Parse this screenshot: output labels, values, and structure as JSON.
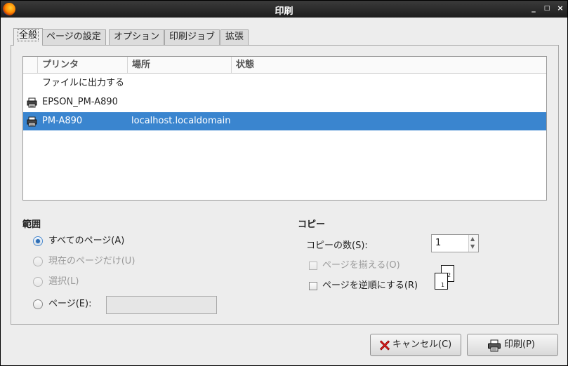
{
  "window": {
    "title": "印刷",
    "controls": [
      "_",
      "□",
      "×"
    ]
  },
  "tabs": [
    {
      "label": "全般",
      "active": true
    },
    {
      "label": "ページの設定",
      "active": false
    },
    {
      "label": "オプション",
      "active": false
    },
    {
      "label": "印刷ジョブ",
      "active": false
    },
    {
      "label": "拡張",
      "active": false
    }
  ],
  "printer_list": {
    "columns": [
      "プリンタ",
      "場所",
      "状態"
    ],
    "rows": [
      {
        "name": "ファイルに出力する",
        "location": "",
        "status": "",
        "icon": null,
        "selected": false
      },
      {
        "name": "EPSON_PM-A890",
        "location": "",
        "status": "",
        "icon": "printer-icon",
        "selected": false
      },
      {
        "name": "PM-A890",
        "location": "localhost.localdomain",
        "status": "",
        "icon": "printer-icon",
        "selected": true
      }
    ]
  },
  "range": {
    "title": "範囲",
    "all_pages": "すべてのページ(A)",
    "current_page": "現在のページだけ(U)",
    "selection": "選択(L)",
    "pages": "ページ(E):",
    "pages_value": ""
  },
  "copies": {
    "title": "コピー",
    "count_label": "コピーの数(S):",
    "count_value": "1",
    "collate": "ページを揃える(O)",
    "reverse": "ページを逆順にする(R)",
    "collate_icon_pages": [
      "1",
      "2"
    ]
  },
  "buttons": {
    "cancel": "キャンセル(C)",
    "print": "印刷(P)"
  },
  "colors": {
    "selection": "#3a85cf",
    "titlebar": "#2a2a2a"
  }
}
